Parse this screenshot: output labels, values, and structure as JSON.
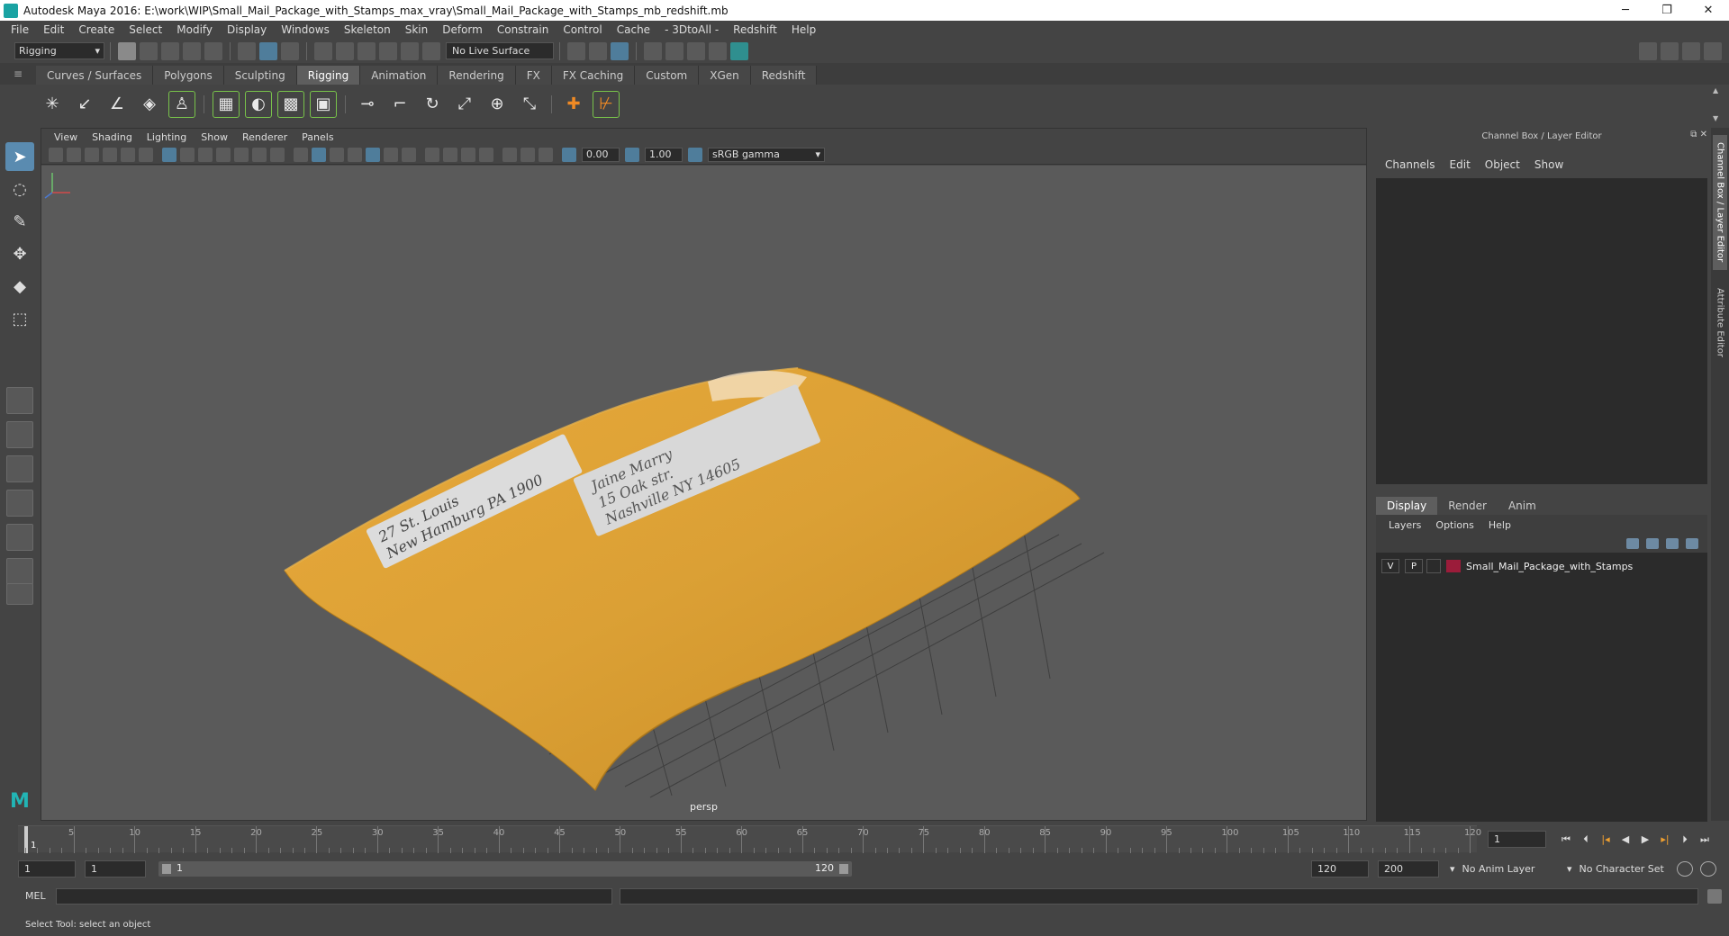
{
  "window": {
    "title": "Autodesk Maya 2016: E:\\work\\WIP\\Small_Mail_Package_with_Stamps_max_vray\\Small_Mail_Package_with_Stamps_mb_redshift.mb",
    "minimize": "─",
    "restore": "❐",
    "close": "✕"
  },
  "menubar": [
    "File",
    "Edit",
    "Create",
    "Select",
    "Modify",
    "Display",
    "Windows",
    "Skeleton",
    "Skin",
    "Deform",
    "Constrain",
    "Control",
    "Cache",
    "- 3DtoAll -",
    "Redshift",
    "Help"
  ],
  "statusline": {
    "mode": "Rigging",
    "live_surface": "No Live Surface"
  },
  "shelf": {
    "tabs": [
      "Curves / Surfaces",
      "Polygons",
      "Sculpting",
      "Rigging",
      "Animation",
      "Rendering",
      "FX",
      "FX Caching",
      "Custom",
      "XGen",
      "Redshift"
    ],
    "active_tab": "Rigging"
  },
  "viewport": {
    "menu": [
      "View",
      "Shading",
      "Lighting",
      "Show",
      "Renderer",
      "Panels"
    ],
    "exposure": "0.00",
    "gamma": "1.00",
    "color_space": "sRGB gamma",
    "camera": "persp",
    "label_line_1": "27 St. Louis",
    "label_line_2": "New Hamburg PA 1900",
    "label2_line_1": "Jaine Marry",
    "label2_line_2": "15 Oak str.",
    "label2_line_3": "Nashville NY 14605"
  },
  "channel_box": {
    "title": "Channel Box / Layer Editor",
    "menu": [
      "Channels",
      "Edit",
      "Object",
      "Show"
    ]
  },
  "layer_editor": {
    "tabs": [
      "Display",
      "Render",
      "Anim"
    ],
    "active_tab": "Display",
    "menu": [
      "Layers",
      "Options",
      "Help"
    ],
    "layers": [
      {
        "visible": "V",
        "playback": "P",
        "name": "Small_Mail_Package_with_Stamps",
        "color": "#9b1c3a"
      }
    ]
  },
  "side_tabs": [
    "Channel Box / Layer Editor",
    "Attribute Editor"
  ],
  "timeline": {
    "start": 1,
    "end": 120,
    "step": 5,
    "current_frame": "1",
    "current_frame_label": "1"
  },
  "range": {
    "start": "1",
    "playback_start": "1",
    "slider_start": "1",
    "slider_end": "120",
    "playback_end": "120",
    "end": "200",
    "anim_layer": "No Anim Layer",
    "character_set": "No Character Set"
  },
  "command_line": {
    "label": "MEL"
  },
  "help_line": {
    "text": "Select Tool: select an object"
  },
  "colors": {
    "package": "#e2a33a",
    "accent": "#5a8bb0",
    "layer_color": "#9b1c3a"
  }
}
